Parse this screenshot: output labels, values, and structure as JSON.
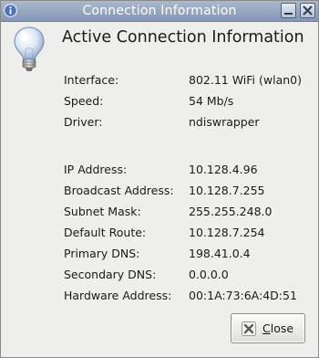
{
  "window": {
    "title": "Connection Information"
  },
  "titlebar_buttons": {
    "minimize": "minimize-icon",
    "close": "close-icon"
  },
  "heading": "Active Connection Information",
  "rows": [
    {
      "label": "Interface:",
      "value": "802.11 WiFi (wlan0)"
    },
    {
      "label": "Speed:",
      "value": "54 Mb/s"
    },
    {
      "label": "Driver:",
      "value": "ndiswrapper"
    },
    {
      "label": "IP Address:",
      "value": "10.128.4.96"
    },
    {
      "label": "Broadcast Address:",
      "value": "10.128.7.255"
    },
    {
      "label": "Subnet Mask:",
      "value": "255.255.248.0"
    },
    {
      "label": "Default Route:",
      "value": "10.128.7.254"
    },
    {
      "label": "Primary DNS:",
      "value": "198.41.0.4"
    },
    {
      "label": "Secondary DNS:",
      "value": "0.0.0.0"
    },
    {
      "label": "Hardware Address:",
      "value": "00:1A:73:6A:4D:51"
    }
  ],
  "close_button": {
    "label": "Close"
  },
  "colors": {
    "titlebar": "#8e9fbc",
    "window_bg": "#eeeeec",
    "text": "#1a1a1a"
  }
}
